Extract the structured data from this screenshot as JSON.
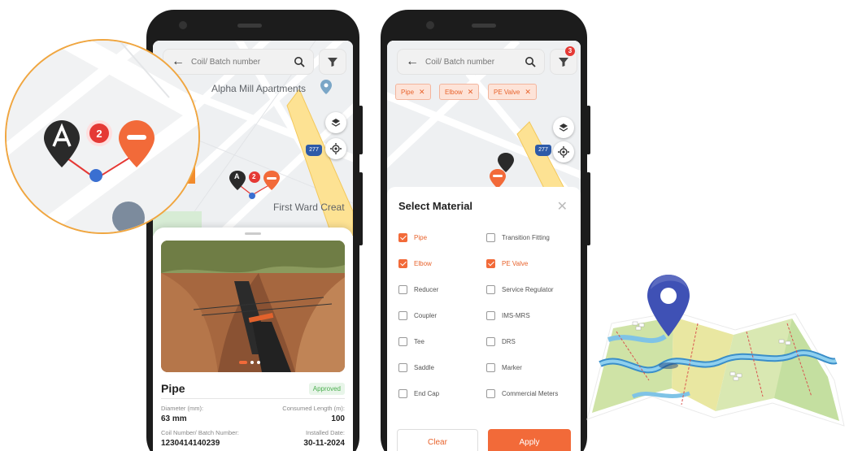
{
  "search": {
    "placeholder": "Coil/ Batch number"
  },
  "map": {
    "label_apartments": "Alpha Mill Apartments",
    "label_first_ward": "First Ward Creat",
    "highway_shield": "277",
    "cluster_count": "2",
    "cluster_letter": "A"
  },
  "detail": {
    "title": "Pipe",
    "status": "Approved",
    "diameter_label": "Diameter (mm):",
    "diameter_value": "63 mm",
    "consumed_label": "Consumed Length (m):",
    "consumed_value": "100",
    "coil_label": "Coil Number/ Batch Number:",
    "coil_value": "1230414140239",
    "installed_label": "Installed Date:",
    "installed_value": "30-11-2024",
    "carousel_count": 3,
    "carousel_active": 1
  },
  "filter": {
    "badge_count": "3",
    "chips": [
      {
        "label": "Pipe"
      },
      {
        "label": "Elbow"
      },
      {
        "label": "PE Valve"
      }
    ],
    "dialog_title": "Select Material",
    "materials": [
      {
        "label": "Pipe",
        "checked": true
      },
      {
        "label": "Transition Fitting",
        "checked": false
      },
      {
        "label": "Elbow",
        "checked": true
      },
      {
        "label": "PE Valve",
        "checked": true
      },
      {
        "label": "Reducer",
        "checked": false
      },
      {
        "label": "Service Regulator",
        "checked": false
      },
      {
        "label": "Coupler",
        "checked": false
      },
      {
        "label": "IMS-MRS",
        "checked": false
      },
      {
        "label": "Tee",
        "checked": false
      },
      {
        "label": "DRS",
        "checked": false
      },
      {
        "label": "Saddle",
        "checked": false
      },
      {
        "label": "Marker",
        "checked": false
      },
      {
        "label": "End Cap",
        "checked": false
      },
      {
        "label": "Commercial Meters",
        "checked": false
      }
    ],
    "clear_label": "Clear",
    "apply_label": "Apply"
  },
  "colors": {
    "accent": "#f26a39",
    "approved": "#4caf50",
    "badge": "#e53935",
    "pin_blue": "#3f51b5"
  }
}
